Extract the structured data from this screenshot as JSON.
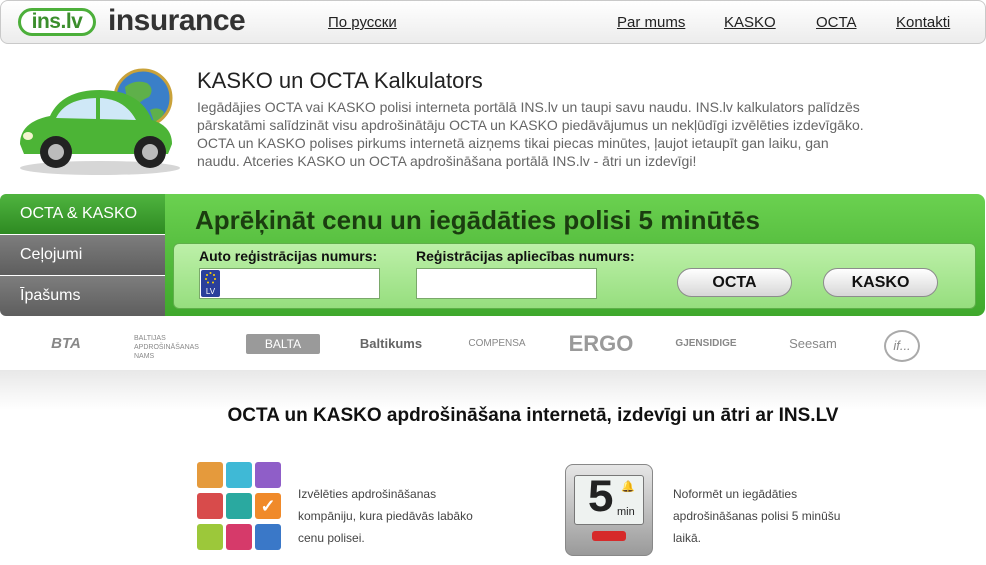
{
  "header": {
    "logo_badge": "ins.lv",
    "logo_word": "insurance",
    "lang_link": "По русски",
    "nav": [
      "Par mums",
      "KASKO",
      "OCTA",
      "Kontakti"
    ]
  },
  "intro": {
    "title": "KASKO un OCTA Kalkulators",
    "text": "Iegādājies OCTA vai KASKO polisi interneta portālā INS.lv un taupi savu naudu. INS.lv kalkulators palīdzēs pārskatāmi salīdzināt visu apdrošinātāju OCTA un KASKO piedāvājumus un nekļūdīgi izvēlēties izdevīgāko. OCTA un KASKO polises pirkums internetā aizņems tikai piecas minūtes, ļaujot ietaupīt gan laiku, gan naudu. Atceries KASKO un OCTA apdrošināšana portālā INS.lv - ātri un izdevīgi!"
  },
  "calculator": {
    "tabs": [
      "OCTA & KASKO",
      "Ceļojumi",
      "Īpašums"
    ],
    "heading": "Aprēķināt cenu un iegādāties polisi 5 minūtēs",
    "reg_number_label": "Auto reģistrācijas numurs:",
    "reg_cert_label": "Reģistrācijas apliecības numurs:",
    "reg_number_value": "",
    "reg_cert_value": "",
    "plate_country": "LV",
    "buttons": [
      "OCTA",
      "KASKO"
    ]
  },
  "insurers": [
    "BTA",
    "BALTIJAS APDROŠINĀŠANAS NAMS",
    "BALTA",
    "Baltikums",
    "COMPENSA",
    "ERGO",
    "GJENSIDIGE",
    "Seesam",
    "if..."
  ],
  "bottom": {
    "headline": "OCTA un KASKO apdrošināšana internetā, izdevīgi un ātri ar INS.LV",
    "feature1": {
      "line1": "Izvēlēties apdrošināšanas",
      "line2": "kompāniju, kura piedāvās labāko",
      "line3": "cenu polisei."
    },
    "feature2": {
      "line1": "Noformēt un iegādāties",
      "line2": "apdrošināšanas polisi 5 minūšu",
      "line3": "laikā."
    },
    "timer_digit": "5",
    "timer_unit": "min"
  },
  "colors": {
    "brand_green": "#4caf3a",
    "tab_grey": "#6e6e6e",
    "panel_green": "#57c240"
  }
}
